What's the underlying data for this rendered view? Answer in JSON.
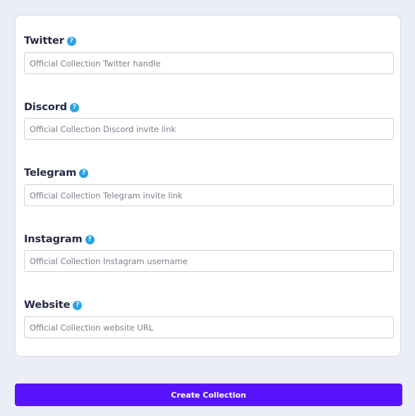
{
  "fields": [
    {
      "label": "Twitter",
      "placeholder": "Official Collection Twitter handle",
      "value": ""
    },
    {
      "label": "Discord",
      "placeholder": "Official Collection Discord invite link",
      "value": ""
    },
    {
      "label": "Telegram",
      "placeholder": "Official Collection Telegram invite link",
      "value": ""
    },
    {
      "label": "Instagram",
      "placeholder": "Official Collection Instagram username",
      "value": ""
    },
    {
      "label": "Website",
      "placeholder": "Official Collection website URL",
      "value": ""
    }
  ],
  "help_icon": {
    "glyph": "?",
    "icon": "question-circle-icon",
    "color": "#29a3e3"
  },
  "submit": {
    "label": "Create Collection",
    "color": "#5813fb"
  }
}
